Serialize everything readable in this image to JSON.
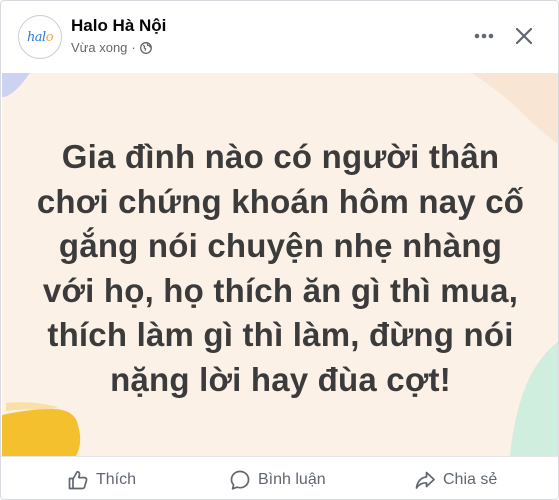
{
  "post": {
    "page_name": "Halo Hà Nội",
    "timestamp": "Vừa xong",
    "separator": "·",
    "avatar_text": "halo",
    "lines": [
      "Gia đình nào có người thân",
      "chơi chứng khoán hôm nay cố",
      "gắng nói chuyện nhẹ nhàng",
      "với họ, họ thích ăn gì thì mua,",
      "thích làm gì thì làm, đừng nói",
      "nặng lời hay đùa cợt!"
    ],
    "background_color": "#fcf1e7"
  },
  "header": {
    "more_icon": "more-options-icon",
    "close_icon": "close-icon",
    "privacy_icon": "globe-icon"
  },
  "actions": {
    "like_label": "Thích",
    "comment_label": "Bình luận",
    "share_label": "Chia sẻ"
  },
  "colors": {
    "text_primary": "#050505",
    "text_secondary": "#65676b",
    "action_text": "#606770",
    "blob_purple": "#ccd2ef",
    "blob_yellow": "#f5c02e",
    "blob_green": "#cfeedd",
    "blob_peach": "#f7dfcc"
  }
}
